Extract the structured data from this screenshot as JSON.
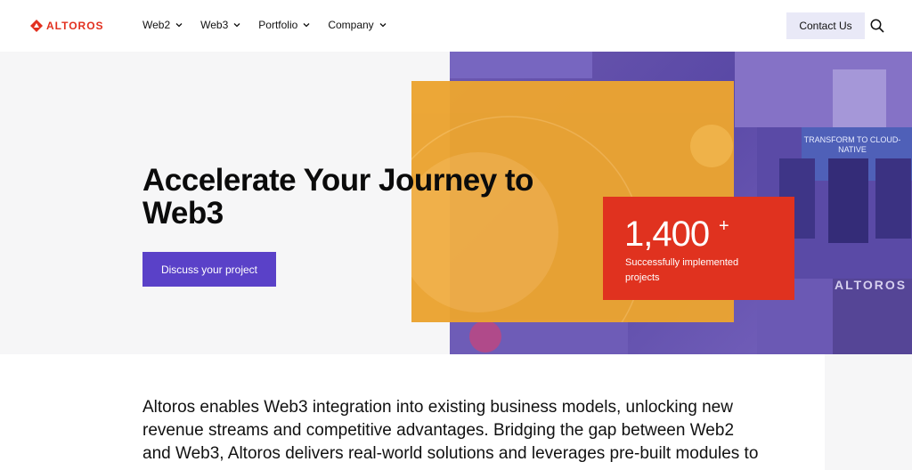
{
  "header": {
    "logo_text": "ALTOROS",
    "nav": [
      {
        "label": "Web2"
      },
      {
        "label": "Web3"
      },
      {
        "label": "Portfolio"
      },
      {
        "label": "Company"
      }
    ],
    "contact_label": "Contact Us"
  },
  "hero": {
    "title": "Accelerate Your Journey to Web3",
    "cta_label": "Discuss your project",
    "stat_number": "1,400",
    "stat_plus": "+",
    "stat_label": "Successfully implemented projects",
    "banner_text": "TRANSFORM TO CLOUD-NATIVE",
    "banner_logo": "ALTOROS"
  },
  "body": {
    "paragraph": "Altoros enables Web3 integration into existing business models, unlocking new revenue streams and competitive advantages. Bridging the gap between Web2 and Web3, Altoros delivers real-world solutions and leverages pre-built modules to"
  },
  "colors": {
    "brand_red": "#e2301f",
    "cta_purple": "#5a41c8",
    "orange": "#eba431",
    "photo_tint": "#5c4aa3"
  }
}
